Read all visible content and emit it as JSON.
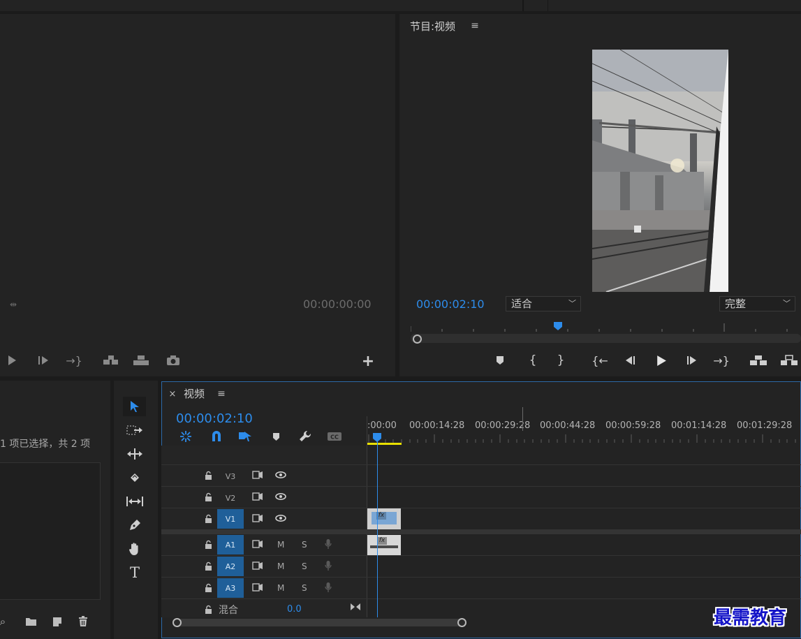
{
  "source_monitor": {
    "timecode": "00:00:00:00"
  },
  "program_monitor": {
    "title": "节目:视频",
    "timecode": "00:00:02:10",
    "zoom_select": "适合",
    "quality_select": "完整"
  },
  "project_panel": {
    "selection_status": "1 项已选择，共 2 项"
  },
  "timeline": {
    "tab_title": "视频",
    "close_label": "×",
    "timecode": "00:00:02:10",
    "ruler_labels": [
      ":00:00",
      "00:00:14:28",
      "00:00:29:28",
      "00:00:44:28",
      "00:00:59:28",
      "00:01:14:28",
      "00:01:29:28"
    ],
    "video_tracks": [
      "V3",
      "V2",
      "V1"
    ],
    "audio_tracks": [
      "A1",
      "A2",
      "A3"
    ],
    "mute_label": "M",
    "solo_label": "S",
    "mix_label": "混合",
    "mix_value": "0.0",
    "clip_fx_label": "fx"
  },
  "watermark": "最需教育",
  "colors": {
    "accent_blue": "#2d8ceb",
    "track_target_blue": "#1f5f99",
    "playhead_yellow": "#e8e000",
    "panel_bg": "#232323"
  }
}
